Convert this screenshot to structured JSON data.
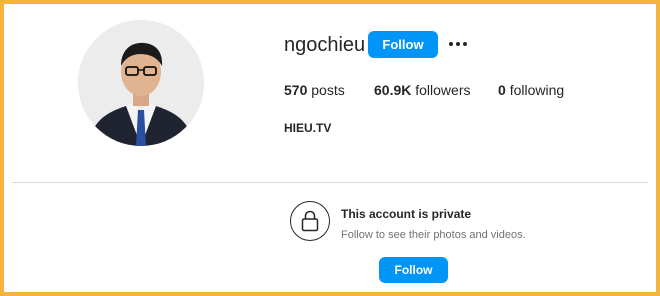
{
  "profile": {
    "username": "ngochieu",
    "follow_label": "Follow",
    "more_icon": "more-options-icon",
    "avatar_alt": "Profile photo",
    "full_name": "HIEU.TV",
    "stats": {
      "posts_count": "570",
      "posts_label": "posts",
      "followers_count": "60.9K",
      "followers_label": "followers",
      "following_count": "0",
      "following_label": "following"
    }
  },
  "private_notice": {
    "icon": "lock-icon",
    "title": "This account is private",
    "subtitle": "Follow to see their photos and videos.",
    "follow_label": "Follow"
  },
  "colors": {
    "accent": "#0095f6",
    "frame": "#f3b33d",
    "divider": "#dbdbdb",
    "muted_text": "#737373"
  }
}
